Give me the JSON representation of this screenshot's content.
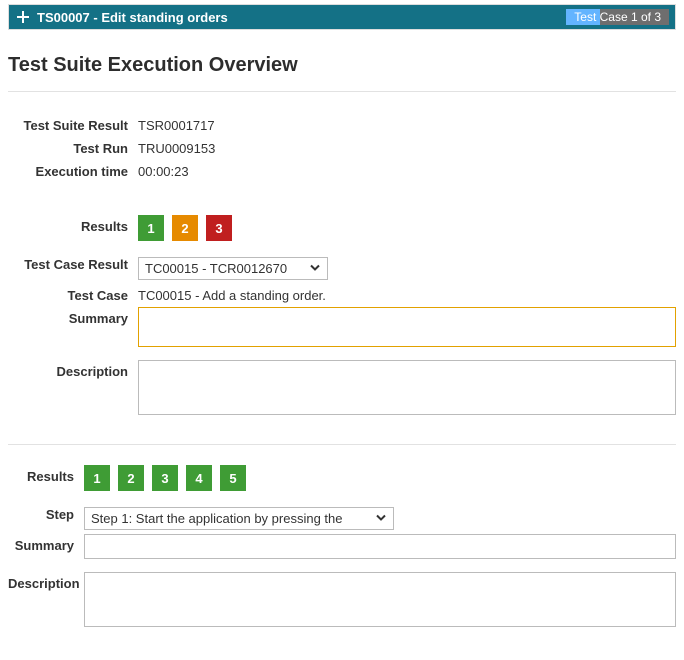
{
  "header": {
    "title": "TS00007 - Edit standing orders",
    "badge": "Test Case 1 of 3"
  },
  "page_title": "Test Suite Execution Overview",
  "suite": {
    "result_label": "Test Suite Result",
    "result_value": "TSR0001717",
    "run_label": "Test Run",
    "run_value": "TRU0009153",
    "time_label": "Execution time",
    "time_value": "00:00:23"
  },
  "case_section": {
    "results_label": "Results",
    "chips": [
      {
        "n": "1",
        "color": "green"
      },
      {
        "n": "2",
        "color": "orange"
      },
      {
        "n": "3",
        "color": "red"
      }
    ],
    "tcr_label": "Test Case Result",
    "tcr_value": "TC00015 - TCR0012670",
    "tc_label": "Test Case",
    "tc_value": "TC00015 - Add a standing order.",
    "summary_label": "Summary",
    "summary_value": "",
    "desc_label": "Description",
    "desc_value": ""
  },
  "step_section": {
    "results_label": "Results",
    "chips": [
      {
        "n": "1",
        "color": "green"
      },
      {
        "n": "2",
        "color": "green"
      },
      {
        "n": "3",
        "color": "green"
      },
      {
        "n": "4",
        "color": "green"
      },
      {
        "n": "5",
        "color": "green"
      }
    ],
    "step_label": "Step",
    "step_value": "Step 1: Start the application by pressing the",
    "summary_label": "Summary",
    "summary_value": "",
    "desc_label": "Description",
    "desc_value": ""
  }
}
